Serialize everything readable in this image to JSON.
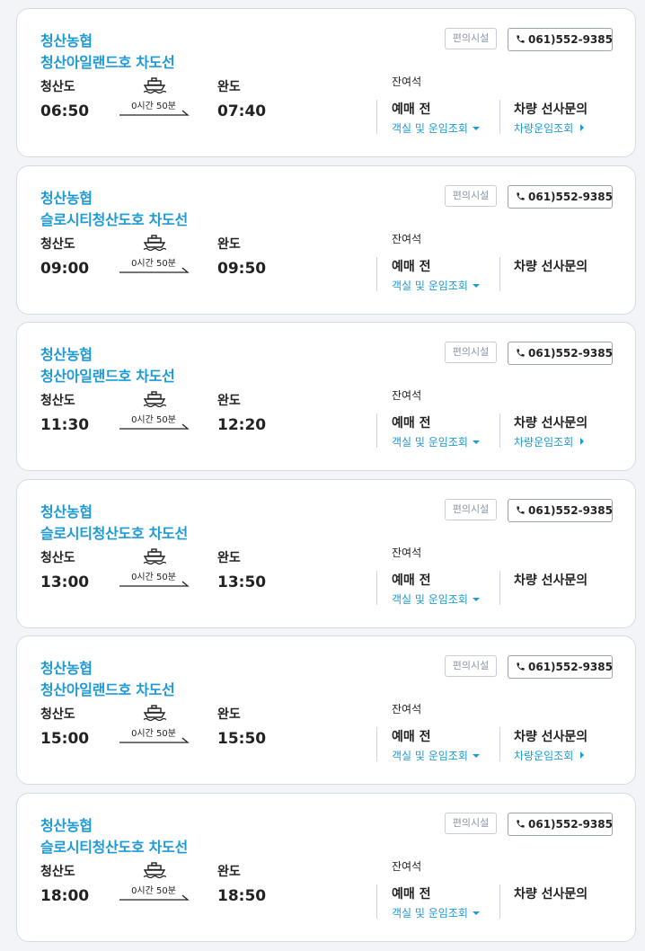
{
  "colors": {
    "accent": "#1e9ad6",
    "text": "#222222",
    "border": "#d6dbe3",
    "background": "#f3f4f7"
  },
  "icons": {
    "ship": "ship-icon",
    "phone": "phone-icon",
    "arrow": "arrow-right-icon"
  },
  "routes": [
    {
      "company": "청산농협",
      "ship": "청산아일랜드호 차도선",
      "facility_label": "편의시설",
      "phone": "061)552-9385",
      "dep_port": "청산도",
      "dep_time": "06:50",
      "duration": "0시간 50분",
      "arr_port": "완도",
      "arr_time": "07:40",
      "seats_label": "잔여석",
      "presale": "예매 전",
      "cabin_link": "객실 및 운임조회",
      "vehicle_label": "차량 선사문의",
      "vehicle_link": "차량운임조회"
    },
    {
      "company": "청산농협",
      "ship": "슬로시티청산도호 차도선",
      "facility_label": "편의시설",
      "phone": "061)552-9385",
      "dep_port": "청산도",
      "dep_time": "09:00",
      "duration": "0시간 50분",
      "arr_port": "완도",
      "arr_time": "09:50",
      "seats_label": "잔여석",
      "presale": "예매 전",
      "cabin_link": "객실 및 운임조회",
      "vehicle_label": "차량 선사문의",
      "vehicle_link": ""
    },
    {
      "company": "청산농협",
      "ship": "청산아일랜드호 차도선",
      "facility_label": "편의시설",
      "phone": "061)552-9385",
      "dep_port": "청산도",
      "dep_time": "11:30",
      "duration": "0시간 50분",
      "arr_port": "완도",
      "arr_time": "12:20",
      "seats_label": "잔여석",
      "presale": "예매 전",
      "cabin_link": "객실 및 운임조회",
      "vehicle_label": "차량 선사문의",
      "vehicle_link": "차량운임조회"
    },
    {
      "company": "청산농협",
      "ship": "슬로시티청산도호 차도선",
      "facility_label": "편의시설",
      "phone": "061)552-9385",
      "dep_port": "청산도",
      "dep_time": "13:00",
      "duration": "0시간 50분",
      "arr_port": "완도",
      "arr_time": "13:50",
      "seats_label": "잔여석",
      "presale": "예매 전",
      "cabin_link": "객실 및 운임조회",
      "vehicle_label": "차량 선사문의",
      "vehicle_link": ""
    },
    {
      "company": "청산농협",
      "ship": "청산아일랜드호 차도선",
      "facility_label": "편의시설",
      "phone": "061)552-9385",
      "dep_port": "청산도",
      "dep_time": "15:00",
      "duration": "0시간 50분",
      "arr_port": "완도",
      "arr_time": "15:50",
      "seats_label": "잔여석",
      "presale": "예매 전",
      "cabin_link": "객실 및 운임조회",
      "vehicle_label": "차량 선사문의",
      "vehicle_link": "차량운임조회"
    },
    {
      "company": "청산농협",
      "ship": "슬로시티청산도호 차도선",
      "facility_label": "편의시설",
      "phone": "061)552-9385",
      "dep_port": "청산도",
      "dep_time": "18:00",
      "duration": "0시간 50분",
      "arr_port": "완도",
      "arr_time": "18:50",
      "seats_label": "잔여석",
      "presale": "예매 전",
      "cabin_link": "객실 및 운임조회",
      "vehicle_label": "차량 선사문의",
      "vehicle_link": ""
    }
  ]
}
